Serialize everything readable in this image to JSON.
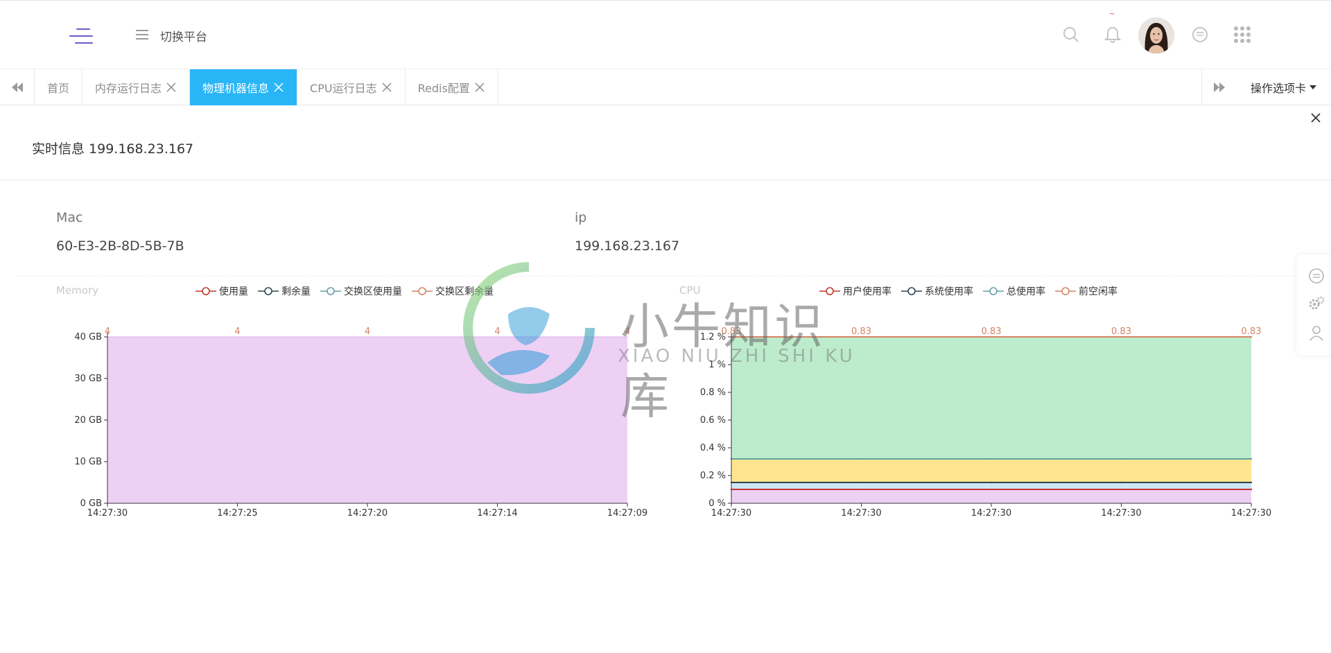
{
  "header": {
    "platform_title": "切换平台",
    "icons": [
      "search-icon",
      "bell-icon",
      "avatar",
      "chat-icon",
      "apps-grid-icon"
    ]
  },
  "tabs": {
    "items": [
      {
        "label": "首页",
        "closable": false,
        "active": false
      },
      {
        "label": "内存运行日志",
        "closable": true,
        "active": false
      },
      {
        "label": "物理机器信息",
        "closable": true,
        "active": true
      },
      {
        "label": "CPU运行日志",
        "closable": true,
        "active": false
      },
      {
        "label": "Redis配置",
        "closable": true,
        "active": false
      }
    ],
    "actions_label": "操作选项卡",
    "active_color": "#29b6f6"
  },
  "panel": {
    "title": "实时信息 199.168.23.167",
    "mac_label": "Mac",
    "mac_value": "60-E3-2B-8D-5B-7B",
    "ip_label": "ip",
    "ip_value": "199.168.23.167"
  },
  "watermark": {
    "title": "小牛知识库",
    "subtitle": "XIAO NIU ZHI SHI KU"
  },
  "chart_data": [
    {
      "type": "area",
      "title": "Memory",
      "legend": [
        "使用量",
        "剩余量",
        "交换区使用量",
        "交换区剩余量"
      ],
      "legend_colors": [
        "#c23531",
        "#2f4554",
        "#61a0a8",
        "#d48265"
      ],
      "x": [
        "14:27:30",
        "14:27:25",
        "14:27:20",
        "14:27:14",
        "14:27:09"
      ],
      "y_ticks": [
        "0 GB",
        "10 GB",
        "20 GB",
        "30 GB",
        "40 GB"
      ],
      "ylim": [
        0,
        40
      ],
      "y_unit": "GB",
      "fill_color": "#eed0f5",
      "data_labels": [
        "4",
        "4",
        "4",
        "4",
        "4"
      ],
      "data_label_color": "#d48265"
    },
    {
      "type": "area",
      "title": "CPU",
      "legend": [
        "用户使用率",
        "系统使用率",
        "总使用率",
        "前空闲率"
      ],
      "legend_colors": [
        "#c23531",
        "#2f4554",
        "#61a0a8",
        "#d48265"
      ],
      "x": [
        "14:27:30",
        "14:27:30",
        "14:27:30",
        "14:27:30",
        "14:27:30"
      ],
      "y_ticks": [
        "0 %",
        "0.2 %",
        "0.4 %",
        "0.6 %",
        "0.8 %",
        "1 %",
        "1.2 %"
      ],
      "ylim": [
        0,
        1.2
      ],
      "y_unit": "%",
      "series": [
        {
          "name": "用户使用率",
          "values": [
            0.1,
            0.1,
            0.1,
            0.1,
            0.1
          ],
          "color": "#c23531",
          "fill": "#eed0f5"
        },
        {
          "name": "系统使用率",
          "values": [
            0.15,
            0.15,
            0.15,
            0.15,
            0.15
          ],
          "color": "#2f4554",
          "fill": "#cfe6f5"
        },
        {
          "name": "总使用率",
          "values": [
            0.32,
            0.32,
            0.32,
            0.32,
            0.32
          ],
          "color": "#61a0a8",
          "fill": "#ffe58f"
        },
        {
          "name": "前空闲率",
          "values": [
            1.2,
            1.2,
            1.2,
            1.2,
            1.2
          ],
          "color": "#d48265",
          "fill": "#bdeccc"
        }
      ],
      "data_labels": [
        "0.83",
        "0.83",
        "0.83",
        "0.83",
        "0.83"
      ],
      "data_label_color": "#d48265"
    }
  ]
}
